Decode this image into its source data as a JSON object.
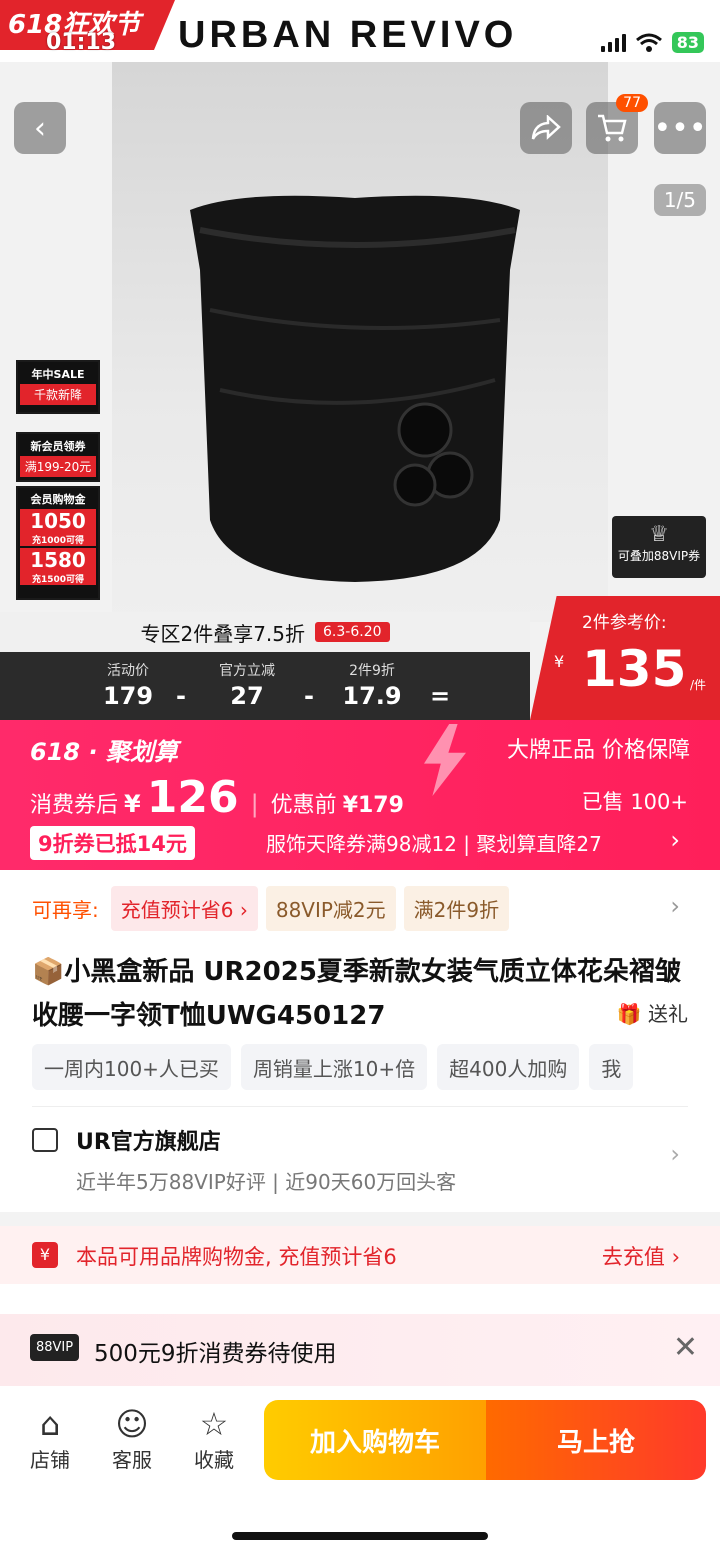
{
  "status_bar": {
    "time": "01:13",
    "battery": "83"
  },
  "top_banner": {
    "festival": "618狂欢节",
    "brand": "URBAN  REVIVO"
  },
  "gallery": {
    "cart_count": "77",
    "page_indicator": "1/5"
  },
  "promo_tiles": {
    "sale": {
      "title": "年中SALE",
      "sub": "千款新降"
    },
    "new_member": {
      "title": "新会员领券",
      "sub": "满199-20元"
    },
    "member_gold": {
      "title": "会员购物金",
      "amt1": "1050",
      "amt1_sub": "充1000可得",
      "amt2": "1580",
      "amt2_sub": "充1500可得"
    }
  },
  "vip_tile": "可叠加88VIP券",
  "zone_bar": {
    "text": "专区2件叠享7.5折",
    "date": "6.3-6.20"
  },
  "calc": {
    "items": [
      {
        "label": "活动价",
        "value": "179"
      },
      {
        "label": "官方立减",
        "value": "27"
      },
      {
        "label": "2件9折",
        "value": "17.9"
      }
    ],
    "ops": [
      "-",
      "-",
      "="
    ]
  },
  "ref_price": {
    "label": "2件参考价:",
    "symbol": "¥",
    "value": "135",
    "unit": "/件"
  },
  "ju": {
    "logo": "618 · 聚划算",
    "slogan": "大牌正品 价格保障",
    "after_label": "消费券后",
    "yen": "¥",
    "price": "126",
    "before_label": "优惠前",
    "before_price": "¥179",
    "sold": "已售 100+",
    "coupon": "9折券已抵14元",
    "note": "服饰天降券满98减12 | 聚划算直降27"
  },
  "more_promos": {
    "label": "可再享:",
    "pills": [
      "充值预计省6 ›",
      "88VIP减2元",
      "满2件9折"
    ]
  },
  "product": {
    "title": "📦小黑盒新品 UR2025夏季新款女装气质立体花朵褶皱收腰一字领T恤UWG450127",
    "gift": "送礼"
  },
  "tags": [
    "一周内100+人已买",
    "周销量上涨10+倍",
    "超400人加购",
    "我"
  ],
  "shop": {
    "name": "UR官方旗舰店",
    "meta": "近半年5万88VIP好评 | 近90天60万回头客"
  },
  "charge": {
    "icon": "¥",
    "text": "本品可用品牌购物金, 充值预计省6",
    "link": "去充值 ›"
  },
  "vip_banner": {
    "logo": "88VIP",
    "text": "500元9折消费券待使用"
  },
  "bottom_nav": {
    "shop": "店铺",
    "service": "客服",
    "fav": "收藏",
    "cart_btn": "加入购物车",
    "buy_btn": "马上抢"
  },
  "colors": {
    "accent_red": "#e2242b",
    "ju_pink": "#ff1f5a",
    "cart_yellow": "#ffb000",
    "buy_orange": "#ff5000"
  }
}
